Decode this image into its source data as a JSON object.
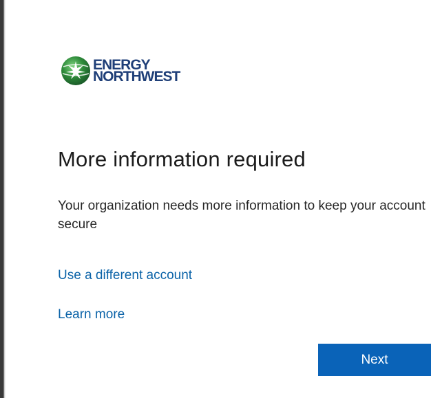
{
  "brand": {
    "line1": "ENERGY",
    "line2": "NORTHWEST",
    "text_color": "#1f3f78",
    "mark_green": "#2e8b3a"
  },
  "page": {
    "title": "More information required",
    "description": "Your organization needs more information to keep your account secure"
  },
  "links": {
    "different_account": "Use a different account",
    "learn_more": "Learn more",
    "color": "#0b63a8"
  },
  "actions": {
    "next_label": "Next",
    "next_bg": "#0a63b8"
  }
}
